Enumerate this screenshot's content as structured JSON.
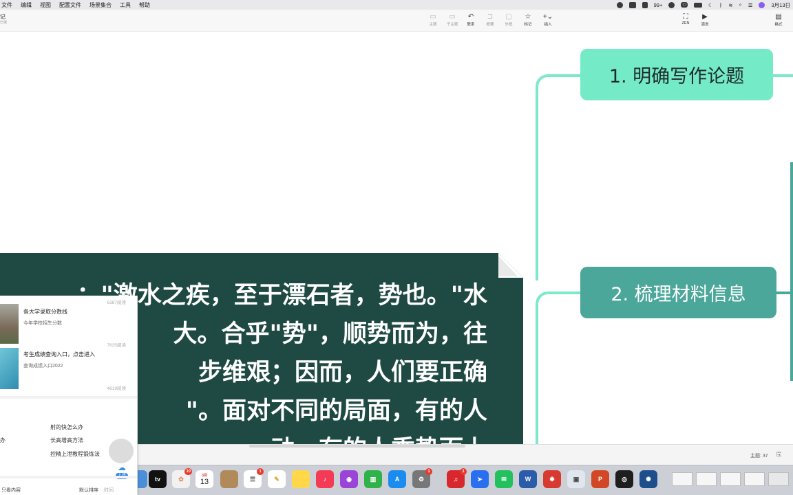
{
  "menubar": {
    "items": [
      "文件",
      "编辑",
      "视图",
      "配置文件",
      "场景集合",
      "工具",
      "帮助"
    ],
    "wechat_badge": "99+",
    "date": "3月13日"
  },
  "toolbar": {
    "title": "记",
    "subtitle": "已保",
    "buttons": [
      {
        "label": "主题",
        "glyph": "▭",
        "active": false
      },
      {
        "label": "子主题",
        "glyph": "▭",
        "active": false
      },
      {
        "label": "联系",
        "glyph": "↶",
        "active": true
      },
      {
        "label": "概要",
        "glyph": "⊐",
        "active": false
      },
      {
        "label": "外框",
        "glyph": "▢",
        "active": false
      },
      {
        "label": "标记",
        "glyph": "☆",
        "active": true
      },
      {
        "label": "插入",
        "glyph": "+⌄",
        "active": true
      },
      {
        "label": "ZEN",
        "glyph": "⛶",
        "active": true
      },
      {
        "label": "演说",
        "glyph": "▶",
        "active": true
      },
      {
        "label": "格式",
        "glyph": "▤",
        "active": true
      }
    ]
  },
  "mindmap": {
    "node1": "1. 明确写作论题",
    "node2": "2. 梳理材料信息",
    "colors": {
      "branch": "#7de8cc",
      "node1": "#74eac7",
      "node2": "#4ba79a",
      "note": "#1f4a43"
    }
  },
  "note": {
    "lines": [
      "：\"激水之疾，至于漂石者，势也。\"水",
      "大。合乎\"势\"，顺势而为，往",
      "步维艰；因而，人们要正确",
      "\"。面对不同的局面，有的人",
      "动，有的人乘势而上"
    ]
  },
  "app_status": {
    "topic_count": "主题: 37"
  },
  "panel": {
    "views_1": "6387阅读",
    "item1_title": "各大学录取分数线",
    "item1_sub": "今年学校招生分数",
    "views_2": "7635阅读",
    "item2_title": "考生成绩查询入口，点击进入",
    "item2_sub": "查询成绩入口2022",
    "views_3": "4619阅读",
    "link_1": "射的快怎么办",
    "link_2_left": "办",
    "link_2": "长高增高方法",
    "link_3": "控精上泄教程锻炼法",
    "upload": "上传",
    "bottom_left": "只看内容",
    "bottom_sort": "默认排序",
    "bottom_time": "时间"
  },
  "dock": {
    "calendar_month": "3月",
    "calendar_day": "13",
    "photos_badge": "10",
    "reminders_badge": "1",
    "settings_badge": "1",
    "netease_badge": "1",
    "tv_label": "tv"
  }
}
